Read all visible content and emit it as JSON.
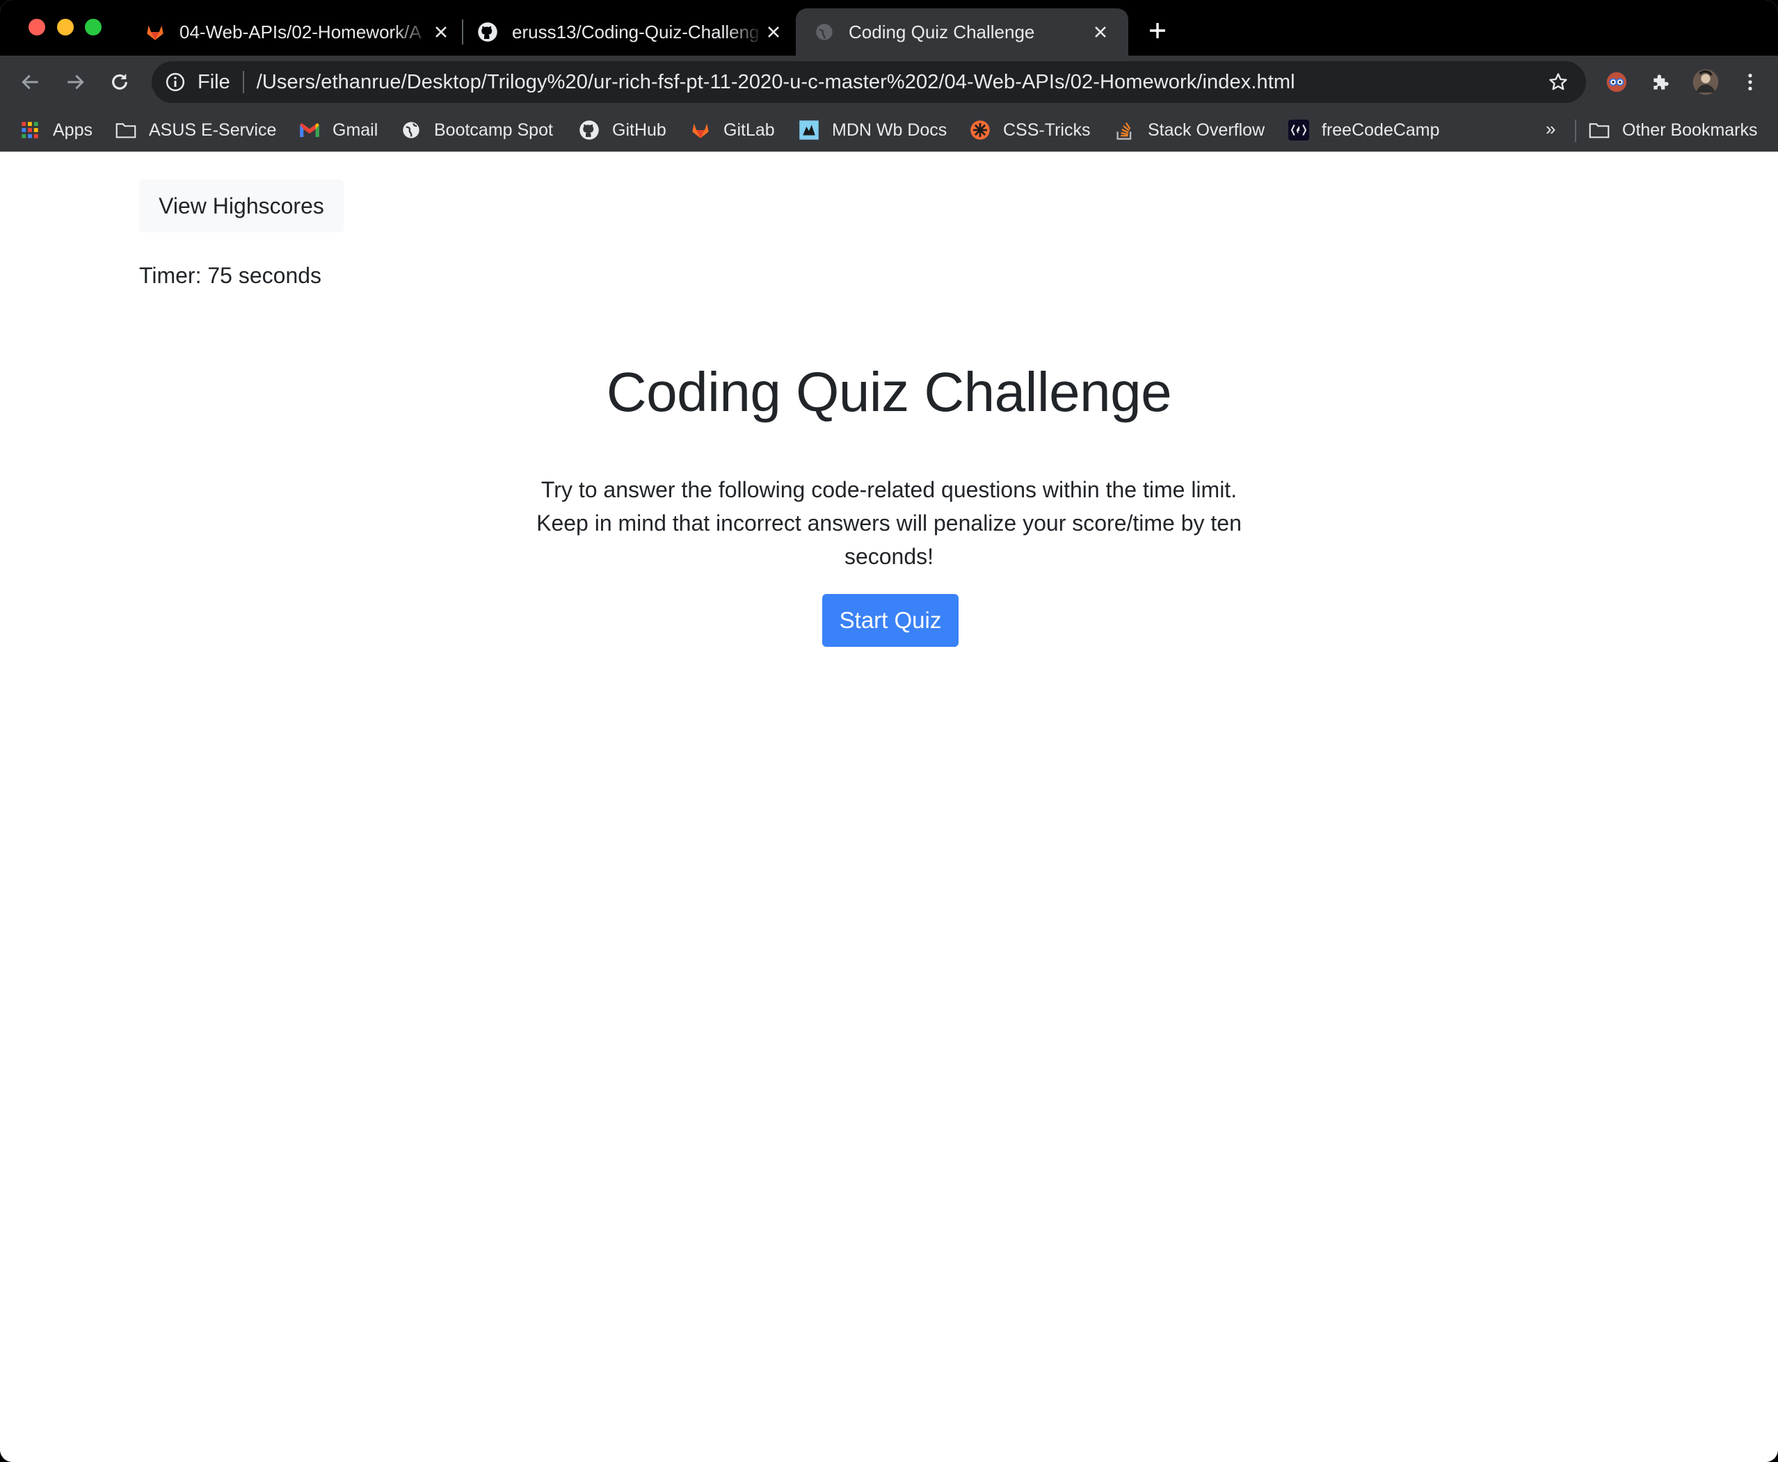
{
  "browser": {
    "tabs": [
      {
        "title": "04-Web-APIs/02-Homework/A",
        "icon": "gitlab-icon"
      },
      {
        "title": "eruss13/Coding-Quiz-Challeng",
        "icon": "github-icon"
      },
      {
        "title": "Coding Quiz Challenge",
        "icon": "globe-icon",
        "active": true
      }
    ],
    "address_bar": {
      "scheme_label": "File",
      "url": "/Users/ethanrue/Desktop/Trilogy%20/ur-rich-fsf-pt-11-2020-u-c-master%202/04-Web-APIs/02-Homework/index.html"
    },
    "bookmarks": [
      {
        "label": "Apps",
        "icon": "apps-grid-icon"
      },
      {
        "label": "ASUS E-Service",
        "icon": "folder-icon"
      },
      {
        "label": "Gmail",
        "icon": "gmail-icon"
      },
      {
        "label": "Bootcamp Spot",
        "icon": "globe-icon"
      },
      {
        "label": "GitHub",
        "icon": "github-icon"
      },
      {
        "label": "GitLab",
        "icon": "gitlab-icon"
      },
      {
        "label": "MDN Wb Docs",
        "icon": "mdn-icon"
      },
      {
        "label": "CSS-Tricks",
        "icon": "css-tricks-icon"
      },
      {
        "label": "Stack Overflow",
        "icon": "stack-overflow-icon"
      },
      {
        "label": "freeCodeCamp",
        "icon": "freecodecamp-icon"
      }
    ],
    "bookmarks_overflow": "»",
    "other_bookmarks": "Other Bookmarks"
  },
  "page": {
    "highscores_button": "View Highscores",
    "timer_text": "Timer: 75 seconds",
    "title": "Coding Quiz Challenge",
    "description": "Try to answer the following code-related questions within the time limit. Keep in mind that incorrect answers will penalize your score/time by ten seconds!",
    "start_button": "Start Quiz"
  },
  "colors": {
    "start_button_bg": "#3a82f7",
    "highscores_button_bg": "#f8f9fa",
    "text": "#212529",
    "chrome_dark": "#35363a"
  }
}
